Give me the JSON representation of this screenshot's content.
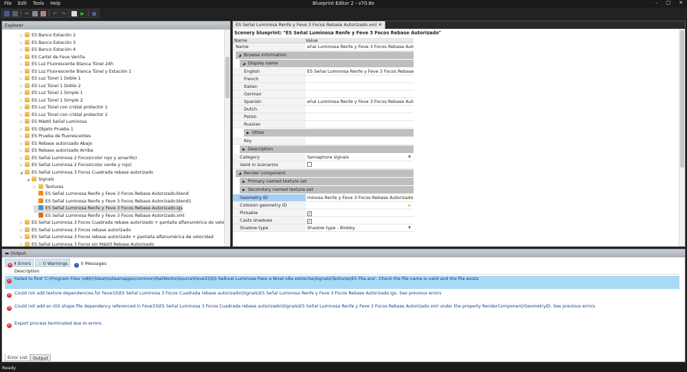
{
  "window": {
    "menu": [
      "File",
      "Edit",
      "Tools",
      "Help"
    ],
    "title": "Blueprint Editor 2 - v70.8e"
  },
  "explorer": {
    "title": "Explorer",
    "items": [
      {
        "label": "ES Banco Estación 2",
        "level": 1,
        "type": "folder",
        "expanded": false
      },
      {
        "label": "ES Banco Estación 3",
        "level": 1,
        "type": "folder",
        "expanded": false
      },
      {
        "label": "ES Banco Estación 4",
        "level": 1,
        "type": "folder",
        "expanded": false
      },
      {
        "label": "ES Cartel de Feve Veriña",
        "level": 1,
        "type": "folder",
        "expanded": false
      },
      {
        "label": "ES Luz Fluorescente Blanca Túnel 24h",
        "level": 1,
        "type": "folder",
        "expanded": false
      },
      {
        "label": "ES Luz Fluorescente Blanca Túnel y Estación 1",
        "level": 1,
        "type": "folder",
        "expanded": false
      },
      {
        "label": "ES Luz Túnel 1 Doble 1",
        "level": 1,
        "type": "folder",
        "expanded": false
      },
      {
        "label": "ES Luz Túnel 1 Doble 2",
        "level": 1,
        "type": "folder",
        "expanded": false
      },
      {
        "label": "ES Luz Túnel 1 Simple 1",
        "level": 1,
        "type": "folder",
        "expanded": false
      },
      {
        "label": "ES Luz Túnel 1 Simple 2",
        "level": 1,
        "type": "folder",
        "expanded": false
      },
      {
        "label": "ES Luz Túnel con cristal protector 1",
        "level": 1,
        "type": "folder",
        "expanded": false
      },
      {
        "label": "ES Luz Túnel con cristal protector 2",
        "level": 1,
        "type": "folder",
        "expanded": false
      },
      {
        "label": "ES Mástil Señal Luminosa",
        "level": 1,
        "type": "folder",
        "expanded": false
      },
      {
        "label": "ES Objeto Prueba 1",
        "level": 1,
        "type": "folder",
        "expanded": false
      },
      {
        "label": "ES Prueba de fluorescentes",
        "level": 1,
        "type": "folder",
        "expanded": false
      },
      {
        "label": "ES Rebase autorizado Abajo",
        "level": 1,
        "type": "folder",
        "expanded": false
      },
      {
        "label": "ES Rebase autorizado Arriba",
        "level": 1,
        "type": "folder",
        "expanded": false
      },
      {
        "label": "ES Señal Luminosa 2 Focos(color rojo y amarillo)",
        "level": 1,
        "type": "folder",
        "expanded": false
      },
      {
        "label": "ES Señal Luminosa 2 Focos(color verde y rojo)",
        "level": 1,
        "type": "folder",
        "expanded": false
      },
      {
        "label": "ES Señal Luminosa 3 Focos Cuadrada rebase autorizado",
        "level": 1,
        "type": "folder",
        "expanded": true
      },
      {
        "label": "Signals",
        "level": 2,
        "type": "folder",
        "expanded": true
      },
      {
        "label": "Textures",
        "level": 3,
        "type": "folder",
        "expanded": false
      },
      {
        "label": "ES Señal Luminosa Renfe y Feve 3 Focos Rebase Autorizado.blend",
        "level": 3,
        "type": "blend"
      },
      {
        "label": "ES Señal Luminosa Renfe y Feve 3 Focos Rebase Autorizado.blend1",
        "level": 3,
        "type": "blend"
      },
      {
        "label": "ES Señal Luminosa Renfe y Feve 3 Focos Rebase Autorizado.igs",
        "level": 3,
        "type": "igs",
        "selected": true
      },
      {
        "label": "ES Señal Luminosa Renfe y Feve 3 Focos Rebase Autorizado.xml",
        "level": 3,
        "type": "xml"
      },
      {
        "label": "ES Señal Luminosa 3 Focos Cuadrada rebase autorizado + pantalla alfanumérica de velocidad",
        "level": 1,
        "type": "folder",
        "expanded": false
      },
      {
        "label": "ES Señal Luminosa 3 Focos rebase autorizado",
        "level": 1,
        "type": "folder",
        "expanded": false
      },
      {
        "label": "ES Señal Luminosa 3 Focos rebase autorizado + pantalla alfanumérica de velocidad",
        "level": 1,
        "type": "folder",
        "expanded": false
      },
      {
        "label": "ES Señal Luminosa 3 Focos sin Mástil Rebase Autorizado",
        "level": 1,
        "type": "folder",
        "expanded": false
      }
    ]
  },
  "editor": {
    "tab": "ES Señal Luminosa Renfe y Feve 3 Focos Rebase Autorizado.xml",
    "tab_close": "✕",
    "title": "Scenery blueprint: \"ES Señal Luminosa Renfe y Feve 3 Focos Rebase Autorizado\"",
    "col_name": "Name",
    "col_value": "Value",
    "rows": [
      {
        "t": "row",
        "k": "Name",
        "v": "eñal Luminosa Renfe y Feve 3 Focos Rebase Autorizado",
        "d": 0
      },
      {
        "t": "grp",
        "k": "Browse information",
        "d": 0,
        "open": true
      },
      {
        "t": "grp",
        "k": "Display name",
        "d": 1,
        "open": true
      },
      {
        "t": "row",
        "k": "English",
        "v": "ES Señal Luminosa Renfe y Feve 3 Focos Rebase Autori:",
        "d": 2
      },
      {
        "t": "row",
        "k": "French",
        "v": "",
        "d": 2
      },
      {
        "t": "row",
        "k": "Italian",
        "v": "",
        "d": 2
      },
      {
        "t": "row",
        "k": "German",
        "v": "",
        "d": 2
      },
      {
        "t": "row",
        "k": "Spanish",
        "v": "eñal Luminosa Renfe y Feve 3 Focos Rebase Autorizado",
        "d": 2
      },
      {
        "t": "row",
        "k": "Dutch",
        "v": "",
        "d": 2
      },
      {
        "t": "row",
        "k": "Polish",
        "v": "",
        "d": 2
      },
      {
        "t": "row",
        "k": "Russian",
        "v": "",
        "d": 2
      },
      {
        "t": "grp",
        "k": "Other",
        "d": 2,
        "open": false
      },
      {
        "t": "row",
        "k": "Key",
        "v": "",
        "d": 2
      },
      {
        "t": "grp",
        "k": "Description",
        "d": 1,
        "open": false
      },
      {
        "t": "row",
        "k": "Category",
        "v": "Semaphore signals",
        "d": 1,
        "dropdown": true
      },
      {
        "t": "row",
        "k": "Valid in scenarios",
        "d": 1,
        "check": false
      },
      {
        "t": "grp",
        "k": "Render component",
        "d": 0,
        "open": true
      },
      {
        "t": "grp",
        "k": "Primary named texture set",
        "d": 1,
        "open": false
      },
      {
        "t": "grp",
        "k": "Secondary named texture set",
        "d": 1,
        "open": false
      },
      {
        "t": "row",
        "k": "Geometry ID",
        "v": "minosa Renfe y Feve 3 Focos Rebase Autorizado.igs",
        "d": 1,
        "browse": true,
        "selected": true
      },
      {
        "t": "row",
        "k": "Collision geometry ID",
        "v": "",
        "d": 1,
        "browse": true
      },
      {
        "t": "row",
        "k": "Pickable",
        "d": 1,
        "check": true
      },
      {
        "t": "row",
        "k": "Casts shadows",
        "d": 1,
        "check": true
      },
      {
        "t": "row",
        "k": "Shadow type",
        "v": "Shadow type - Blobby",
        "d": 1,
        "dropdown": true
      }
    ]
  },
  "output": {
    "title": "Output",
    "errors": "4 Errors",
    "warnings": "0 Warnings",
    "messages": "0 Messages",
    "col_description": "Description",
    "items": [
      "Failed to find 'C:\\Program Files (x86)\\Steam\\steamapps\\common\\RailWorks\\Source\\Feve33\\ES SeÃ±al Luminosa Paso a Nivel vÃa estrecha\\Signals\\Textures\\ES Pila.ace'. Check the file name is valid and the file exists",
      "Could not add texture dependencies for Feve33\\ES Señal Luminosa 3 Focos Cuadrada rebase autorizado\\Signals\\ES Señal Luminosa Renfe y Feve 3 Focos Rebase Autorizado.igs. See previous errors",
      "Could not add an IGS shape file dependency referenced in Feve33\\ES Señal Luminosa 3 Focos Cuadrada rebase autorizado\\Signals\\ES Señal Luminosa Renfe y Feve 3 Focos Rebase Autorizado.xml under the property RenderComponent/GeometryID. See previous errors",
      "Export process terminated due to errors."
    ],
    "bottom_tabs": [
      "Error List",
      "Output"
    ]
  },
  "status": "Ready",
  "colors": {
    "selection": "#a9d9f5",
    "geometry_highlight": "#a8cdf5",
    "error": "#d33333",
    "message_text": "#1a3a8a"
  }
}
